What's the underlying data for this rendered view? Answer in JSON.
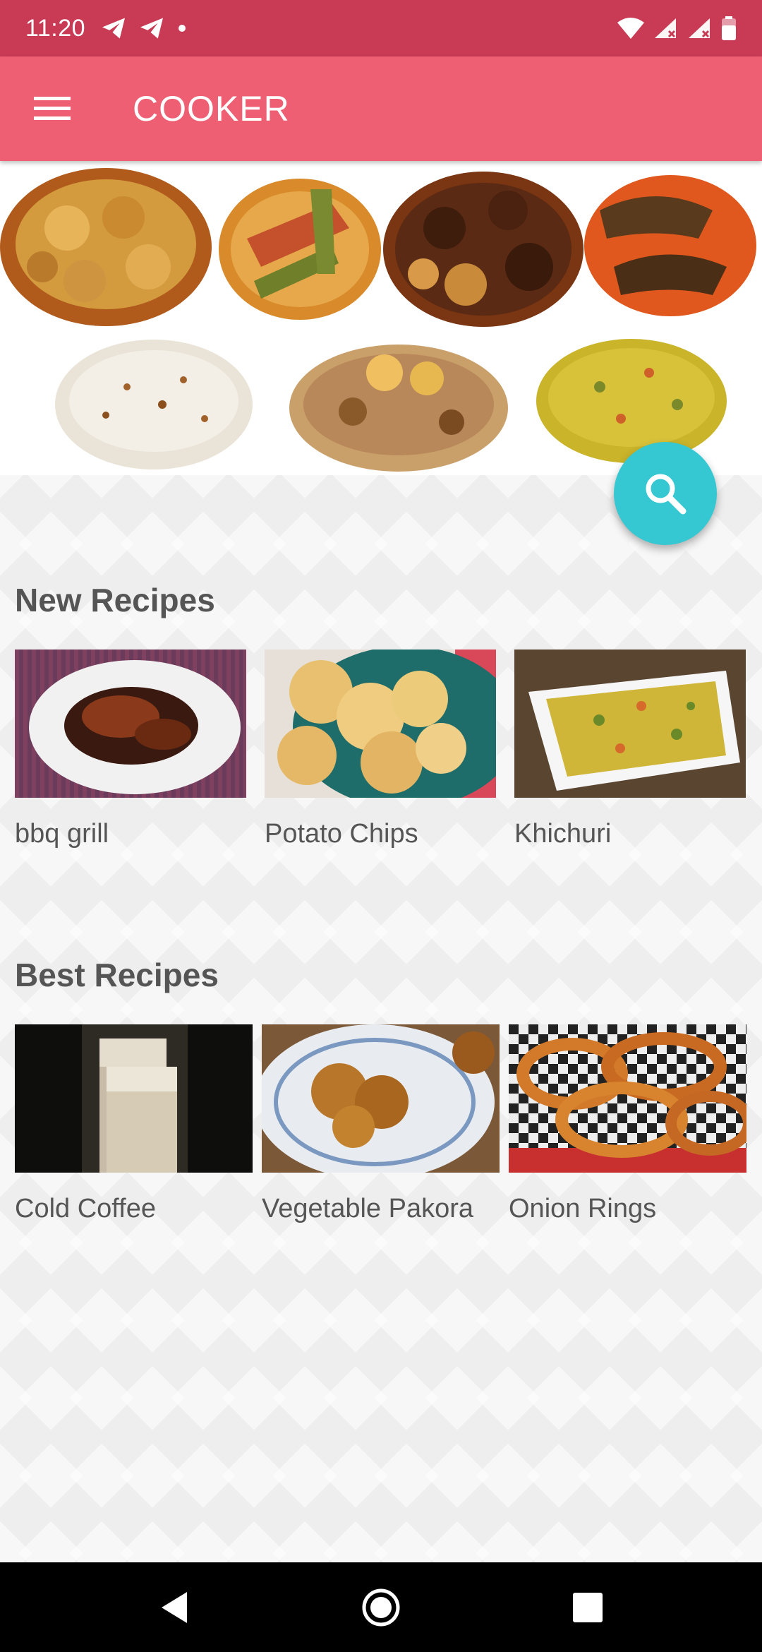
{
  "status_bar": {
    "time": "11:20",
    "icons": [
      "telegram-icon",
      "telegram-icon",
      "notification-dot-icon",
      "wifi-icon",
      "signal-icon",
      "signal-icon",
      "battery-icon"
    ]
  },
  "app_bar": {
    "title": "COOKER",
    "menu_icon": "hamburger-menu-icon"
  },
  "banner": {
    "icon": "food-collage-image"
  },
  "search_fab": {
    "icon": "search-icon",
    "color": "#35c8d2"
  },
  "new_recipes": {
    "title": "New Recipes",
    "items": [
      {
        "label": "bbq grill",
        "image": "bbq-grill-image"
      },
      {
        "label": "Potato Chips",
        "image": "potato-chips-image"
      },
      {
        "label": "Khichuri",
        "image": "khichuri-image"
      }
    ]
  },
  "best_recipes": {
    "title": "Best Recipes",
    "items": [
      {
        "label": "Cold Coffee",
        "image": "cold-coffee-image"
      },
      {
        "label": "Vegetable Pakora",
        "image": "vegetable-pakora-image"
      },
      {
        "label": "Onion Rings",
        "image": "onion-rings-image"
      }
    ]
  },
  "nav_bar": {
    "back_icon": "back-triangle-icon",
    "home_icon": "home-circle-icon",
    "recents_icon": "recents-square-icon"
  },
  "colors": {
    "status_bar": "#c93a55",
    "app_bar": "#ee5f73",
    "section_text": "#555555"
  }
}
